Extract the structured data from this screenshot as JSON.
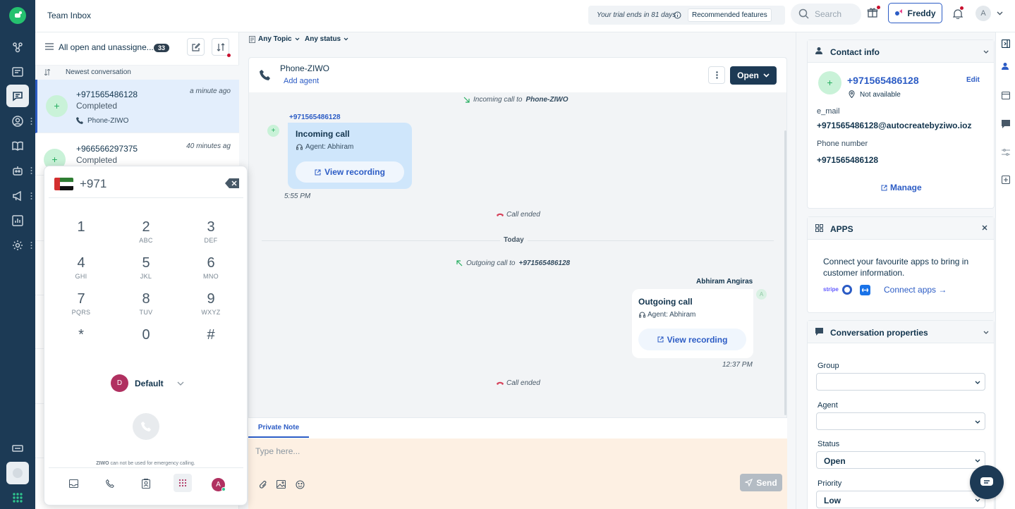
{
  "header": {
    "title": "Team Inbox",
    "trial_text": "Your trial ends in 81 days",
    "recommended": "Recommended features",
    "search_placeholder": "Search",
    "freddy": "Freddy",
    "avatar_initial": "A"
  },
  "list": {
    "filter_title": "All open and unassigne...",
    "count": "33",
    "sort_label": "Newest conversation",
    "conversations": [
      {
        "phone": "+971565486128",
        "time": "a minute ago",
        "status": "Completed",
        "channel": "Phone-ZIWO"
      },
      {
        "phone": "+966566297375",
        "time": "40 minutes ag",
        "status": "Completed"
      }
    ]
  },
  "filters": {
    "topic": "Any Topic",
    "status": "Any status"
  },
  "conversation": {
    "channel": "Phone-ZIWO",
    "add_agent": "Add agent",
    "open_button": "Open",
    "events": {
      "incoming_prefix": "Incoming call to",
      "incoming_target": "Phone-ZIWO",
      "call_ended_1": "Call ended",
      "today": "Today",
      "outgoing_prefix": "Outgoing call to",
      "outgoing_target": "+971565486128",
      "call_ended_2": "Call ended"
    },
    "incoming": {
      "sender": "+971565486128",
      "title": "Incoming call",
      "agent": "Agent: Abhiram",
      "button": "View recording",
      "time": "5:55 PM"
    },
    "outgoing": {
      "sender": "Abhiram Angiras",
      "title": "Outgoing call",
      "agent": "Agent: Abhiram",
      "button": "View recording",
      "time": "12:37 PM"
    },
    "composer": {
      "tab": "Private Note",
      "placeholder": "Type here...",
      "send": "Send"
    }
  },
  "contact": {
    "section_title": "Contact info",
    "phone": "+971565486128",
    "edit": "Edit",
    "availability": "Not available",
    "email_label": "e_mail",
    "email_value": "+971565486128@autocreatebyziwo.ioz",
    "phone_label": "Phone number",
    "phone_value": "+971565486128",
    "manage": "Manage"
  },
  "apps": {
    "title": "APPS",
    "text": "Connect your favourite apps to bring in customer information.",
    "stripe": "stripe",
    "connect": "Connect apps →"
  },
  "properties": {
    "title": "Conversation properties",
    "group_label": "Group",
    "group_value": "",
    "agent_label": "Agent",
    "agent_value": "",
    "status_label": "Status",
    "status_value": "Open",
    "priority_label": "Priority",
    "priority_value": "Low"
  },
  "dialer": {
    "country_code": "+971",
    "keys": [
      {
        "digit": "1",
        "letters": ""
      },
      {
        "digit": "2",
        "letters": "ABC"
      },
      {
        "digit": "3",
        "letters": "DEF"
      },
      {
        "digit": "4",
        "letters": "GHI"
      },
      {
        "digit": "5",
        "letters": "JKL"
      },
      {
        "digit": "6",
        "letters": "MNO"
      },
      {
        "digit": "7",
        "letters": "PQRS"
      },
      {
        "digit": "8",
        "letters": "TUV"
      },
      {
        "digit": "9",
        "letters": "WXYZ"
      },
      {
        "digit": "*",
        "letters": ""
      },
      {
        "digit": "0",
        "letters": ""
      },
      {
        "digit": "#",
        "letters": ""
      }
    ],
    "profile_initial": "D",
    "profile_name": "Default",
    "brand": "ZIWO",
    "notice": "can not be used for emergency calling.",
    "bottom_avatar": "A"
  },
  "colors": {
    "rail": "#1c3a55",
    "accent": "#2c5cc5",
    "navy_button": "#1d3a55",
    "incoming_bubble": "#cfe6fb",
    "composer_bg": "#fdf0e3"
  }
}
